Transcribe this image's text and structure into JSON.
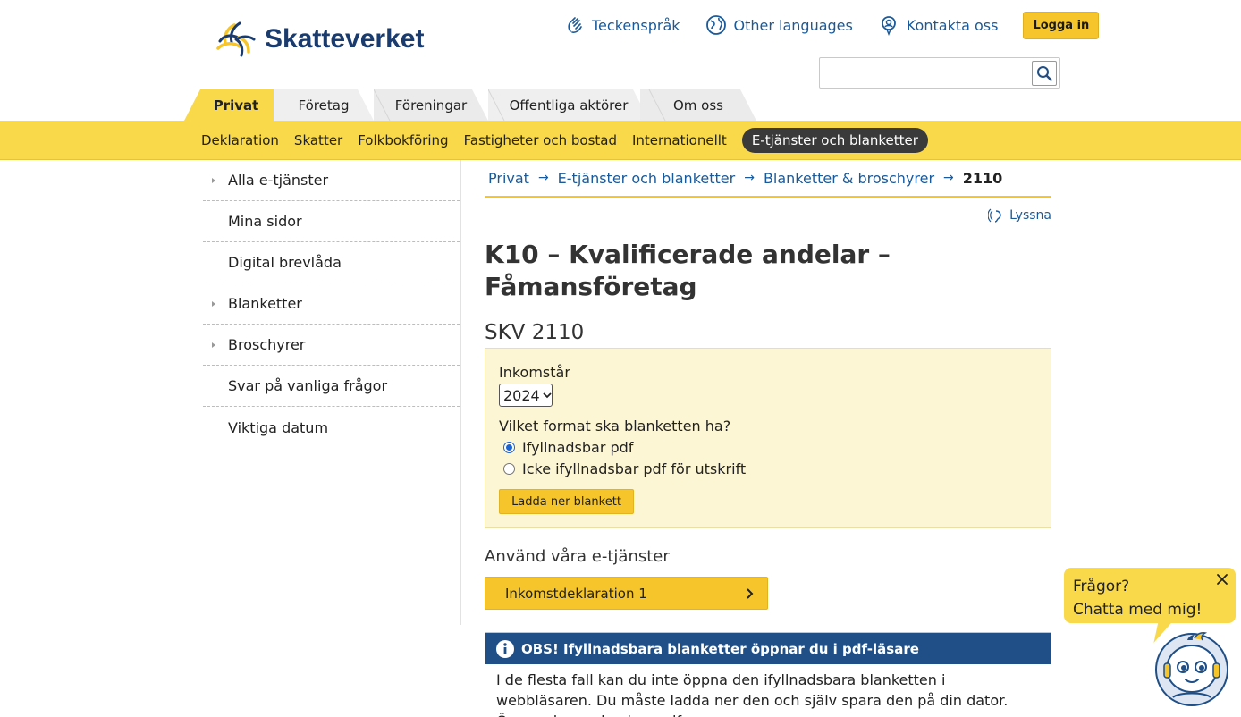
{
  "header": {
    "logo_text": "Skatteverket",
    "links": [
      {
        "label": "Teckenspråk",
        "icon": "sign-language-icon"
      },
      {
        "label": "Other languages",
        "icon": "globe-icon"
      },
      {
        "label": "Kontakta oss",
        "icon": "contact-icon"
      }
    ],
    "login_label": "Logga in",
    "search_placeholder": ""
  },
  "main_tabs": [
    "Privat",
    "Företag",
    "Föreningar",
    "Offentliga aktörer",
    "Om oss"
  ],
  "subnav": [
    "Deklaration",
    "Skatter",
    "Folkbokföring",
    "Fastigheter och bostad",
    "Internationellt",
    "E-tjänster och blanketter"
  ],
  "sidebar": [
    {
      "label": "Alla e-tjänster",
      "arrow": true
    },
    {
      "label": "Mina sidor",
      "arrow": false
    },
    {
      "label": "Digital brevlåda",
      "arrow": false
    },
    {
      "label": "Blanketter",
      "arrow": true
    },
    {
      "label": "Broschyrer",
      "arrow": true
    },
    {
      "label": "Svar på vanliga frågor",
      "arrow": false
    },
    {
      "label": "Viktiga datum",
      "arrow": false
    }
  ],
  "breadcrumb": [
    "Privat",
    "E-tjänster och blanketter",
    "Blanketter & broschyrer",
    "2110"
  ],
  "listen_label": "Lyssna",
  "page": {
    "title_line1": "K10 – Kvalificerade andelar –",
    "title_line2": "Fåmansföretag",
    "form_number": "SKV 2110"
  },
  "form": {
    "income_year_label": "Inkomstår",
    "income_year_value": "2024",
    "format_question": "Vilket format ska blanketten ha?",
    "options": [
      "Ifyllnadsbar pdf",
      "Icke ifyllnadsbar pdf för utskrift"
    ],
    "selected_option": 0,
    "download_label": "Ladda ner blankett"
  },
  "eservices": {
    "heading": "Använd våra e-tjänster",
    "button_label": "Inkomstdeklaration 1"
  },
  "notice": {
    "title": "OBS! Ifyllnadsbara blanketter öppnar du i pdf-läsare",
    "body": "I de flesta fall kan du inte öppna den ifyllnadsbara blanketten i webbläsaren. Du måste ladda ner den och själv spara den på din dator. Öppna den sedan i en pdf-"
  },
  "chat": {
    "line1": "Frågor?",
    "line2": "Chatta med mig!"
  },
  "colors": {
    "brand_yellow": "#f5c52b",
    "nav_yellow": "#f9d84a",
    "link_blue": "#1a5a9a",
    "notice_blue": "#1f4f86",
    "form_bg": "#fdf6d4"
  }
}
